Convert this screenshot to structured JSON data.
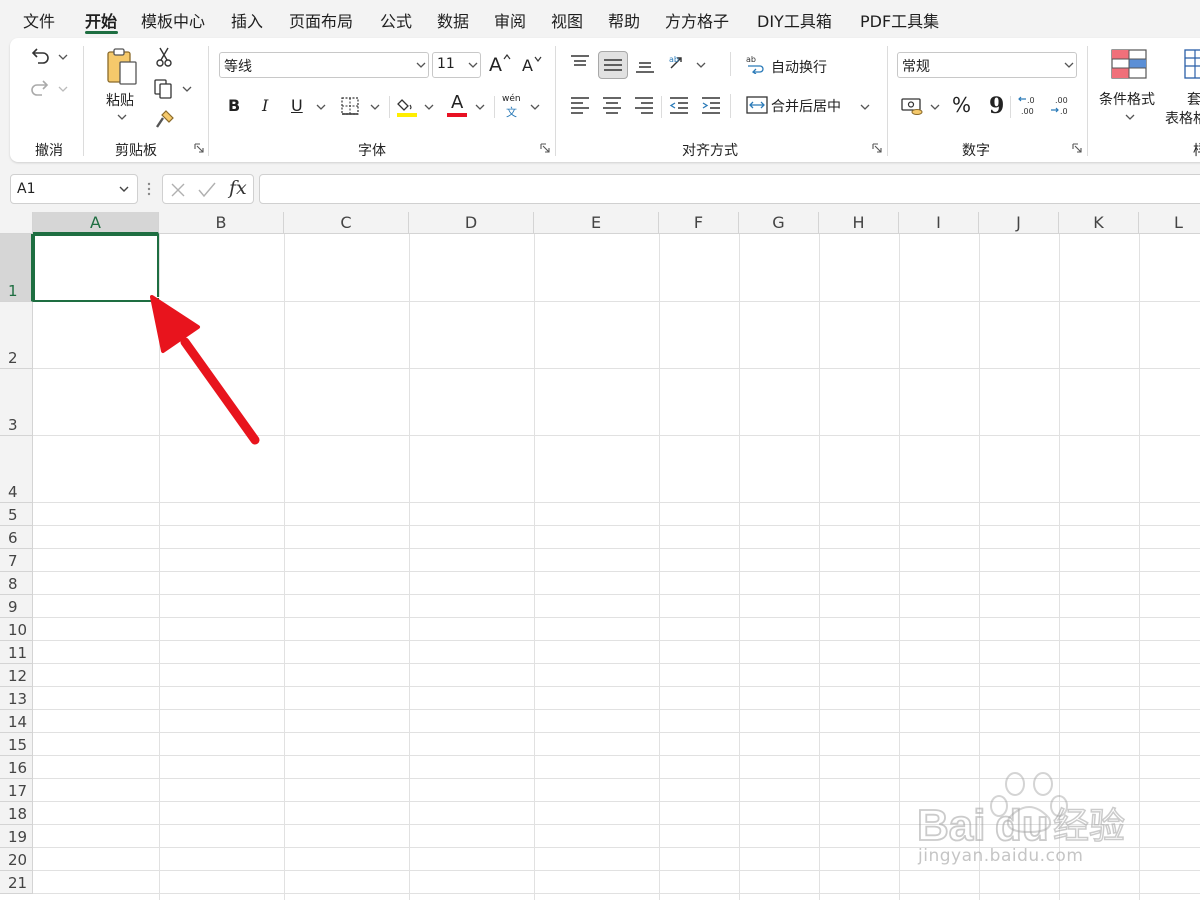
{
  "menu": {
    "tabs": [
      "文件",
      "开始",
      "模板中心",
      "插入",
      "页面布局",
      "公式",
      "数据",
      "审阅",
      "视图",
      "帮助",
      "方方格子",
      "DIY工具箱",
      "PDF工具集"
    ],
    "active": "开始"
  },
  "ribbon": {
    "undo_group": {
      "label": "撤消"
    },
    "clipboard": {
      "label": "剪贴板",
      "paste_label": "粘贴"
    },
    "font": {
      "label": "字体",
      "font_name": "等线",
      "font_size": "11",
      "bold": "B",
      "italic": "I",
      "underline": "U",
      "font_color_glyph": "A",
      "grow_glyph": "A",
      "shrink_glyph": "A",
      "phonetic_top": "wén",
      "phonetic_bottom": "文",
      "highlight_color": "#ffee00",
      "font_color": "#e81123"
    },
    "alignment": {
      "label": "对齐方式",
      "wrap_text": "自动换行",
      "merge_center": "合并后居中"
    },
    "number": {
      "label": "数字",
      "format": "常规",
      "percent": "%",
      "comma": "9",
      "inc_decimal_top": ".0",
      "inc_decimal_bottom": ".00",
      "dec_decimal_top": ".00",
      "dec_decimal_bottom": ".0"
    },
    "styles": {
      "conditional_format": "条件格式",
      "table_format_top": "套",
      "table_format": "表格格",
      "group_label_partial": "样"
    }
  },
  "formula_bar": {
    "name_box": "A1",
    "fx": "fx",
    "formula": ""
  },
  "sheet": {
    "columns": [
      "A",
      "B",
      "C",
      "D",
      "E",
      "F",
      "G",
      "H",
      "I",
      "J",
      "K",
      "L"
    ],
    "rows": [
      "1",
      "2",
      "3",
      "4",
      "5",
      "6",
      "7",
      "8",
      "9",
      "10",
      "11",
      "12",
      "13",
      "14",
      "15",
      "16",
      "17",
      "18",
      "19",
      "20",
      "21"
    ],
    "selected_cell": "A1"
  },
  "watermark": {
    "brand": "Bai",
    "brand2": "du",
    "brand_cn": "经验",
    "url": "jingyan.baidu.com"
  },
  "colors": {
    "accent": "#1e6e41",
    "arrow": "#e8141d"
  }
}
